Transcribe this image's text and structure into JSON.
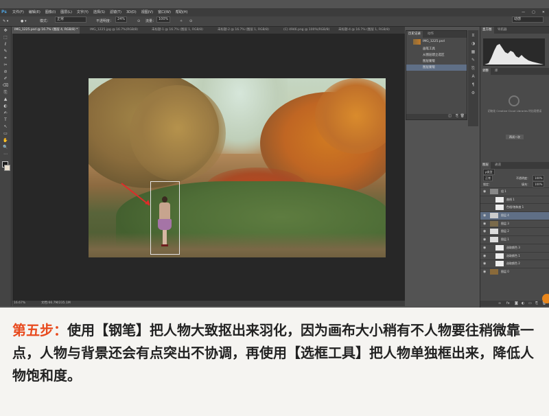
{
  "app": {
    "logo": "Ps",
    "menus": [
      "文件(F)",
      "编辑(E)",
      "图像(I)",
      "图层(L)",
      "文字(Y)",
      "选择(S)",
      "滤镜(T)",
      "3D(D)",
      "视图(V)",
      "窗口(W)",
      "帮助(H)"
    ],
    "window_controls": [
      "—",
      "▢",
      "✕"
    ]
  },
  "options": {
    "style_label": "模式：",
    "style_value": "正常",
    "opacity_label": "不透明度：",
    "opacity_value": "24%",
    "flow_label": "流量：",
    "flow_value": "100%",
    "workspace": "动感"
  },
  "tabs": [
    {
      "label": "IMG_1225.psd @ 16.7% (图层 4, RGB/8) *",
      "active": true
    },
    {
      "label": "IMG_1225.jpg @ 16.7%(RGB/8)",
      "active": false
    },
    {
      "label": "未标题-1 @ 16.7% (图层 1, RGB/8)",
      "active": false
    },
    {
      "label": "未标题-2 @ 16.7% (图层 1, RGB/8)",
      "active": false
    },
    {
      "label": "(C) 4946.png @ 100%(RGB/8)",
      "active": false
    },
    {
      "label": "未标题-4 @ 16.7% (图层 1, RGB/8)",
      "active": false
    }
  ],
  "tools": [
    "✥",
    "⬚",
    "ℓ",
    "✎",
    "⌗",
    "✂",
    "⊘",
    "✐",
    "⌫",
    "⎘",
    "▲",
    "◐",
    "✍",
    "T",
    "↖",
    "▭",
    "✋",
    "🔍",
    "⋯"
  ],
  "status": {
    "zoom": "16.67%",
    "doc": "文档:66.7M/235.1M"
  },
  "history_panel": {
    "tabs": [
      "历史记录",
      "动作"
    ],
    "snapshot": "IMG_1225.psd",
    "rows": [
      {
        "label": "画笔工具",
        "selected": false
      },
      {
        "label": "从图层建立选区",
        "selected": false
      },
      {
        "label": "图层蒙版",
        "selected": false
      },
      {
        "label": "图层蒙版",
        "selected": true
      }
    ]
  },
  "right_panel": {
    "tabs": [
      "直方图",
      "导航器"
    ],
    "libraries_tabs": [
      "调整",
      "库"
    ],
    "library_note": "初始化 Creative Cloud Libraries 时出现错误",
    "library_button": "再试一次",
    "layers_tabs": [
      "图层",
      "通道"
    ],
    "kind_label": "ρ类型",
    "blend": "正常",
    "opacity_label": "不透明度：",
    "opacity": "100%",
    "lock_label": "锁定：",
    "fill_label": "填充：",
    "fill": "100%",
    "layers": [
      {
        "name": "组 1",
        "selected": false
      },
      {
        "name": "曲线 1",
        "selected": false
      },
      {
        "name": "色相/饱和度 1",
        "selected": false
      },
      {
        "name": "图层 4",
        "selected": true
      },
      {
        "name": "图层 3",
        "selected": false
      },
      {
        "name": "图层 2",
        "selected": false
      },
      {
        "name": "图层 1",
        "selected": false
      },
      {
        "name": "选取颜色 3",
        "selected": false
      },
      {
        "name": "选取颜色 1",
        "selected": false
      },
      {
        "name": "选取颜色 2",
        "selected": false
      },
      {
        "name": "图层 0",
        "selected": false
      }
    ]
  },
  "caption": {
    "step": "第五步：",
    "text": "使用【钢笔】把人物大致抠出来羽化，因为画布大小稍有不人物要往稍微靠一点，人物与背景还会有点突出不协调，再使用【选框工具】把人物单独框出来，降低人物饱和度。"
  }
}
